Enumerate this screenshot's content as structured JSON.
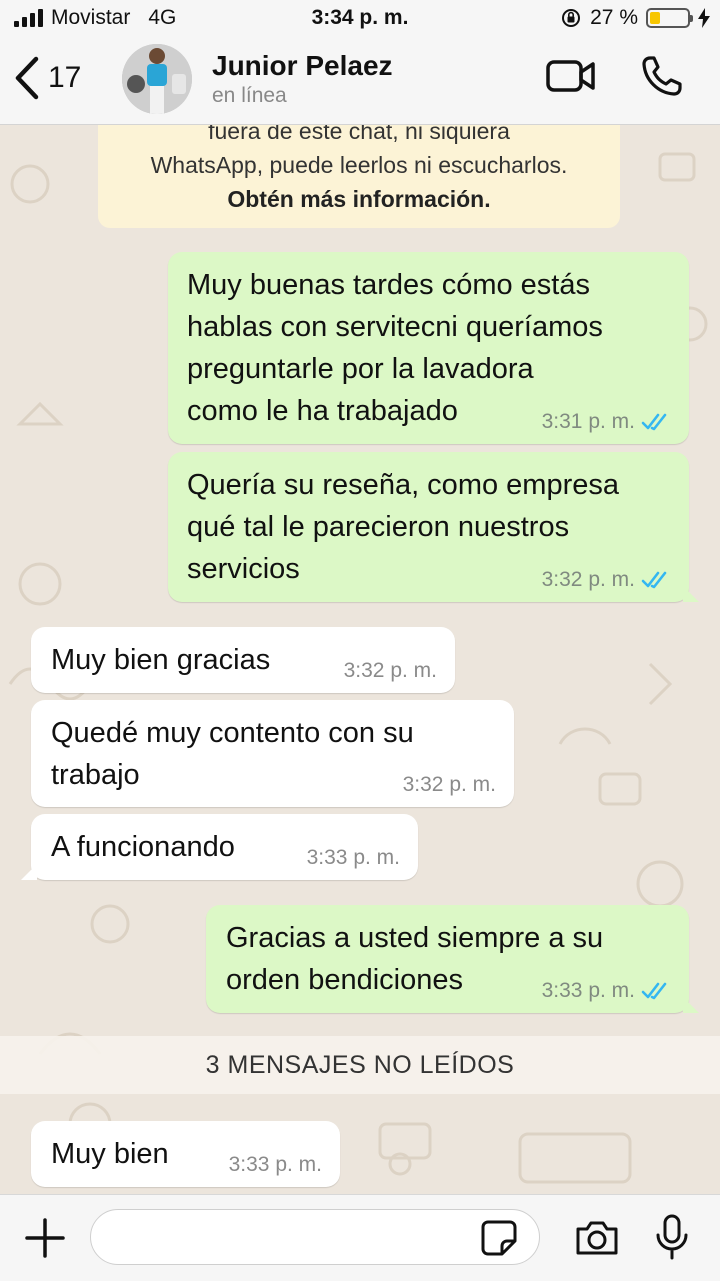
{
  "status_bar": {
    "carrier": "Movistar",
    "network": "4G",
    "time": "3:34 p. m.",
    "battery_text": "27 %",
    "battery_level": 0.27,
    "battery_color": "#f7c600"
  },
  "header": {
    "back_count": "17",
    "contact_name": "Junior Pelaez",
    "contact_status": "en línea",
    "icons": [
      "chevron-left-icon",
      "video-call-icon",
      "phone-icon"
    ]
  },
  "chat": {
    "notice": {
      "line1": "fuera de este chat, ni siquiera",
      "line2": "WhatsApp, puede leerlos ni escucharlos.",
      "link": "Obtén más información."
    },
    "messages": [
      {
        "direction": "outgoing",
        "lines": [
          "Muy buenas tardes cómo estás",
          "hablas con servitecni queríamos",
          "preguntarle por la lavadora",
          "como le ha trabajado"
        ],
        "time": "3:31 p. m.",
        "read": true
      },
      {
        "direction": "outgoing",
        "lines": [
          "Quería su reseña, como empresa",
          "qué tal le parecieron nuestros",
          "servicios"
        ],
        "time": "3:32 p. m.",
        "read": true
      },
      {
        "direction": "incoming",
        "lines": [
          "Muy bien gracias"
        ],
        "time": "3:32 p. m."
      },
      {
        "direction": "incoming",
        "lines": [
          "Quedé muy contento con su",
          "trabajo"
        ],
        "time": "3:32 p. m."
      },
      {
        "direction": "incoming",
        "lines": [
          "A funcionando"
        ],
        "time": "3:33 p. m."
      },
      {
        "direction": "outgoing",
        "lines": [
          "Gracias a usted siempre a su",
          "orden bendiciones"
        ],
        "time": "3:33 p. m.",
        "read": true
      },
      {
        "direction": "incoming",
        "lines": [
          "Muy bien"
        ],
        "time": "3:33 p. m."
      }
    ],
    "unread_divider": "3 MENSAJES NO LEÍDOS"
  },
  "input_bar": {
    "placeholder": "",
    "icons": [
      "plus-icon",
      "sticker-icon",
      "camera-icon",
      "microphone-icon"
    ]
  },
  "colors": {
    "outgoing_bubble": "#dcf8c6",
    "incoming_bubble": "#ffffff",
    "read_ticks": "#34b7f1",
    "wallpaper": "#ece5dc",
    "notice": "#fcf3d6"
  }
}
